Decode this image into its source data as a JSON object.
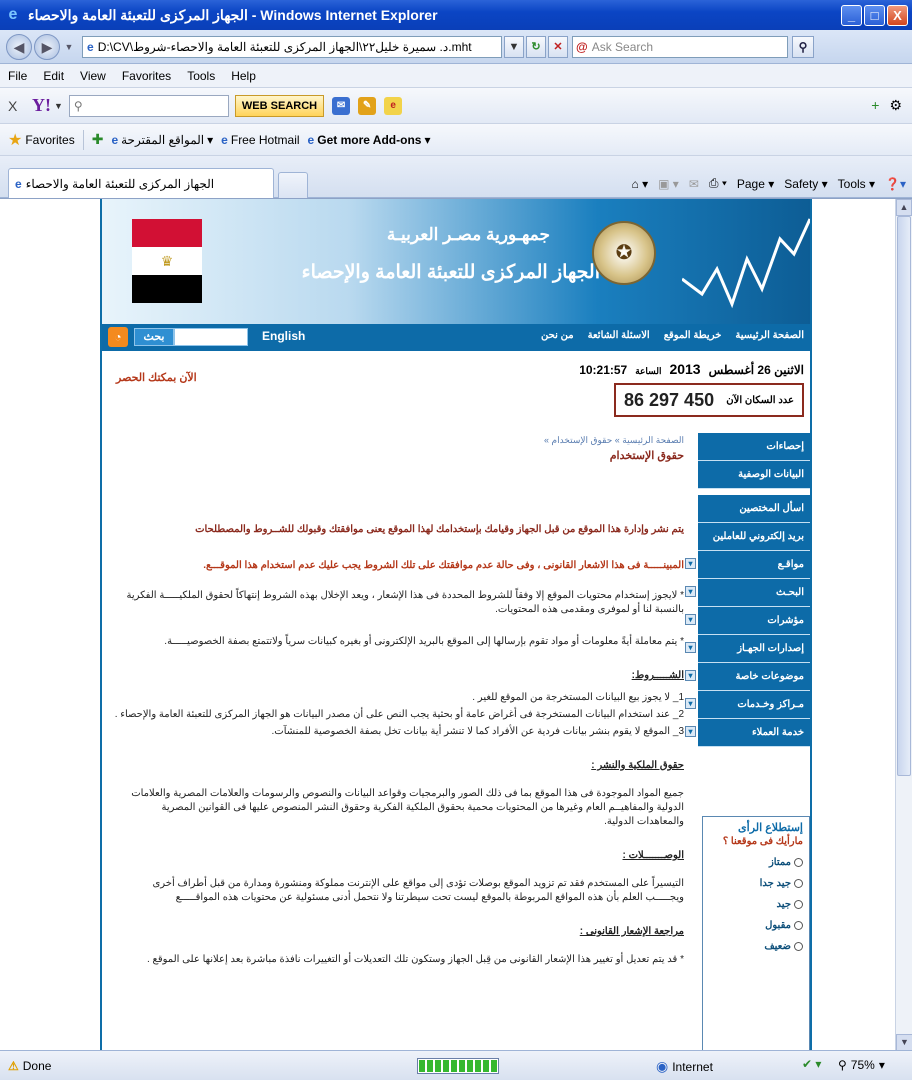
{
  "window": {
    "title": "الجهاز المركزى للتعبئة العامة والاحصاء - Windows Internet Explorer",
    "buttons": {
      "minimize": "_",
      "maximize": "□",
      "close": "X"
    }
  },
  "addressbar": {
    "url": "D:\\CV\\د. سميرة خليل٢٢\\الجهاز المركزى للتعبئة العامة والاحصاء-شروط.mht",
    "search_placeholder": "Ask Search"
  },
  "menubar": [
    "File",
    "Edit",
    "View",
    "Favorites",
    "Tools",
    "Help"
  ],
  "yahoo_toolbar": {
    "web_search": "WEB SEARCH"
  },
  "favorites_bar": {
    "favorites": "Favorites",
    "links": [
      "المواقع المقترحة",
      "Free Hotmail",
      "Get more Add-ons"
    ]
  },
  "tab": {
    "title": "الجهاز المركزى للتعبئة العامة والاحصاء"
  },
  "command_bar": [
    "Page",
    "Safety",
    "Tools"
  ],
  "site": {
    "banner": {
      "country": "جمهـورية مصـر العربيـة",
      "agency": "الجهاز المركزى للتعبئة العامة والإحصاء"
    },
    "search_button": "بحث",
    "english_link": "English",
    "nav_links": [
      "الصفحة الرئيسية",
      "خريطة الموقع",
      "الاسئلة الشائعة",
      "من نحن"
    ],
    "date": {
      "weekday_day": "الاثنين 26 أغسطس",
      "year": "2013",
      "time_label": "الساعة",
      "time": "10:21:57"
    },
    "population": {
      "label": "عدد السكان الآن",
      "value": "86 297 450"
    },
    "census_link": "الآن بمكتك الحصر",
    "sidebar": [
      {
        "label": "إحصاءات",
        "expand": false
      },
      {
        "label": "البيانات الوصفية",
        "expand": false
      },
      {
        "label": "اسأل المختصين",
        "expand": false
      },
      {
        "label": "بريد إلكتروني للعاملين",
        "expand": false
      },
      {
        "label": "مواقـع",
        "expand": true
      },
      {
        "label": "البحـث",
        "expand": true
      },
      {
        "label": "مؤشرات",
        "expand": true
      },
      {
        "label": "إصدارات الجهـاز",
        "expand": true
      },
      {
        "label": "موضوعات خاصة",
        "expand": true
      },
      {
        "label": "مـراكز وخـدمات",
        "expand": true
      },
      {
        "label": "خدمة العملاء",
        "expand": true
      }
    ],
    "poll": {
      "title": "إستطلاع الرأى",
      "question": "مارأيك فى موقعنا ؟",
      "options": [
        "ممتاز",
        "جيد جدا",
        "جيد",
        "مقبول",
        "ضعيف"
      ]
    },
    "content": {
      "breadcrumb": "الصفحة الرئيسية » حقوق الإستخدام »",
      "title": "حقوق الإستخدام",
      "p1": "يتم نشر وإدارة هذا الموقع من قبل الجهاز وقيامك بإستخدامك لهذا الموقع يعنى موافقتك وقبولك للشــروط والمصطلحات",
      "p2": "المبينـــــة فى هذا الاشعار القانونى ، وفى حالة عدم موافقتك على تلك الشروط يجب عليك عدم استخدام هذا الموقـــع.",
      "p3": "* لايجوز إستخدام محتويات الموقع إلا وفقاً للشروط المحددة فى هذا الإشعار ، ويعد الإخلال بهذه الشروط إنتهاكاً لحقوق الملكيـــــة الفكرية بالنسبة لنا أو لموفرى ومقدمى هذه المحتويات.",
      "p4": "* يتم معاملة أيةً معلومات أو مواد تقوم بإرسالها إلى الموقع بالبريد الإلكترونى أو بغيره كبيانات سرياً ولاتتمتع بصفة الخصوصيـــــة.",
      "terms_heading": "الشـــــروط:",
      "terms": [
        "1_ لا يجوز بيع البيانات المستخرجة من الموقع للغير .",
        "2_ عند استخدام البيانات المستخرجة فى أغراض عامة أو بحثية يجب النص على أن مصدر البيانات هو الجهاز المركزى للتعبئة العامة والإحصاء .",
        "3_ الموقع لا يقوم بنشر بيانات فردية عن الأفراد كما لا تنشر أية بيانات تخل بصفة الخصوصية للمنشآت."
      ],
      "ip_heading": "حقوق الملكية والنشر :",
      "ip_text": "جميع المواد الموجودة فى هذا الموقع بما فى ذلك الصور والبرمجيات وقواعد البيانات والنصوص والرسومات والعلامات المصرية والعلامات الدولية والمفاهيــم العام وغيرها من المحتويات محمية بحقوق الملكية الفكرية وحقوق النشر المنصوص عليها فى القوانين المصرية والمعاهدات الدولية.",
      "links_heading": "الوصـــــــلات :",
      "links_text": "التيسيراً على المستخدم فقد تم تزويد الموقع بوصلات تؤدى إلى مواقع على الإنترنت مملوكة ومنشورة ومدارة من قبل أطراف أخرى ويجـــــب العلم بأن هذه المواقع المربوطة بالموقع ليست تحت سيطرتنا ولا نتحمل أدنى مسئولية عن محتويات هذه المواقـــــع",
      "review_heading": "مراجعة الإشعار القانونى :",
      "review_text": "* قد يتم تعديل أو تغيير هذا الإشعار القانونى من قِبل الجهاز وستكون تلك التعديلات أو التغييرات نافذة مباشرة بعد إعلانها على الموقع ."
    }
  },
  "statusbar": {
    "status": "Done",
    "zone": "Internet",
    "zoom": "75%",
    "progress": 1.0
  }
}
